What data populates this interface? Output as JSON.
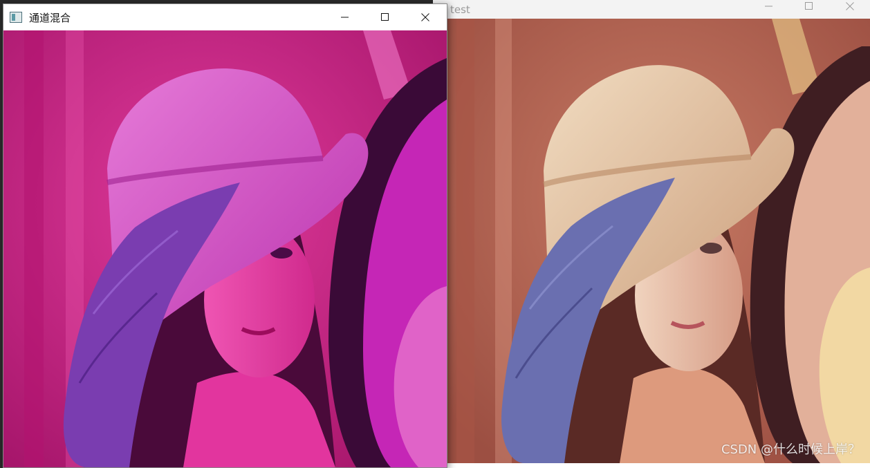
{
  "windows": {
    "test": {
      "title": "test",
      "icon": "app-window-icon",
      "controls": [
        "minimize-icon",
        "maximize-icon",
        "close-icon"
      ],
      "image": {
        "subject": "portrait photo, natural color",
        "colors": {
          "background": "#c06c5a",
          "hat": "#e3c9a7",
          "skin": "#dd9a7d",
          "feather": "#6a6fb0",
          "hair": "#5a2a25",
          "mirror": "#e2b09a"
        }
      },
      "watermark": "CSDN @什么时候上岸？"
    },
    "blend": {
      "title": "通道混合",
      "icon": "app-window-icon",
      "controls": [
        "minimize-icon",
        "maximize-icon",
        "close-icon"
      ],
      "image": {
        "subject": "portrait photo, channel-mixed magenta tint",
        "colors": {
          "background": "#d0207a",
          "hat": "#d84fc8",
          "skin": "#e2359e",
          "feather": "#7a3db0",
          "hair": "#4a0a3a",
          "mirror": "#c526b6"
        }
      }
    }
  }
}
